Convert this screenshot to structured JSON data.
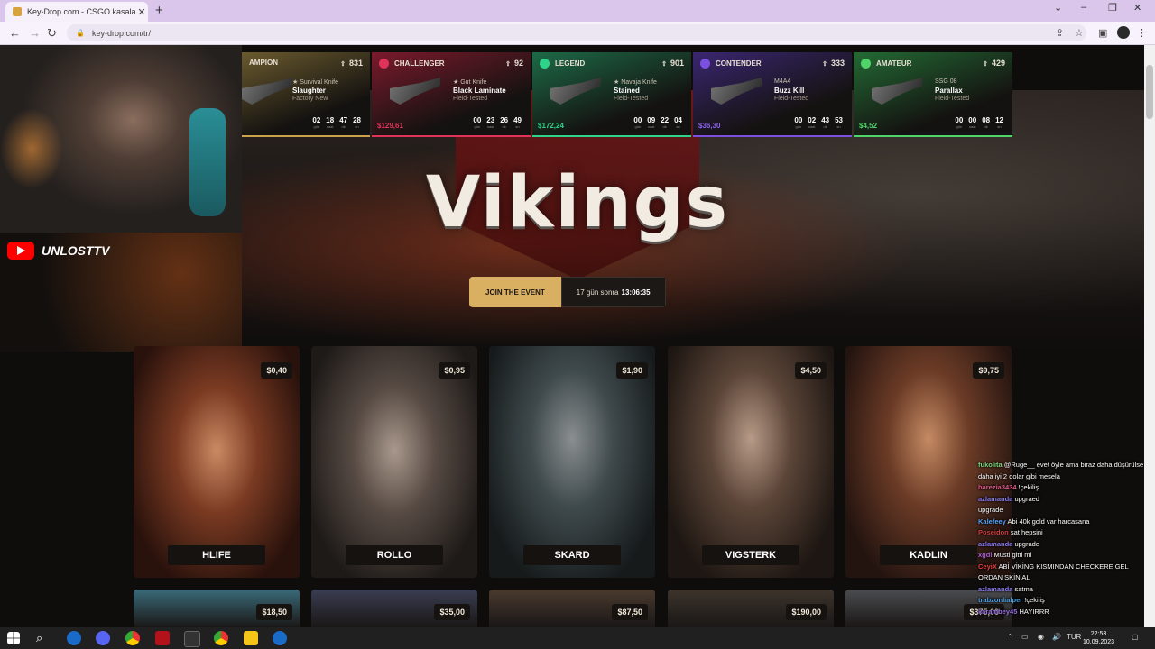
{
  "browser": {
    "tab_title": "Key-Drop.com - CSGO kasaların",
    "tab_close": "✕",
    "new_tab": "+",
    "url": "key-drop.com/tr/"
  },
  "stream": {
    "channel": "UNLOSTTV"
  },
  "ticker": [
    {
      "rank": "AMPION",
      "level": "831",
      "dot": "#c9a24a",
      "weapon": "★ Survival Knife",
      "skin": "Slaughter",
      "wear": "Factory New",
      "price": "",
      "price_color": "#e8c46a",
      "timer": [
        "02",
        "18",
        "47",
        "28"
      ],
      "accent": "#6a5a2e"
    },
    {
      "rank": "CHALLENGER",
      "level": "92",
      "dot": "#e0335a",
      "weapon": "★ Gut Knife",
      "skin": "Black Laminate",
      "wear": "Field-Tested",
      "price": "$129,61",
      "price_color": "#e0335a",
      "timer": [
        "00",
        "23",
        "26",
        "49"
      ],
      "accent": "#7a1a2c"
    },
    {
      "rank": "LEGEND",
      "level": "901",
      "dot": "#2fd48a",
      "weapon": "★ Navaja Knife",
      "skin": "Stained",
      "wear": "Field-Tested",
      "price": "$172,24",
      "price_color": "#2fd48a",
      "timer": [
        "00",
        "09",
        "22",
        "04"
      ],
      "accent": "#1d6a47"
    },
    {
      "rank": "CONTENDER",
      "level": "333",
      "dot": "#7b4fe0",
      "weapon": "M4A4",
      "skin": "Buzz Kill",
      "wear": "Field-Tested",
      "price": "$36,30",
      "price_color": "#8d63f0",
      "timer": [
        "00",
        "02",
        "43",
        "53"
      ],
      "accent": "#3a2670"
    },
    {
      "rank": "AMATEUR",
      "level": "429",
      "dot": "#4fd46a",
      "weapon": "SSG 08",
      "skin": "Parallax",
      "wear": "Field-Tested",
      "price": "$4,52",
      "price_color": "#4fd46a",
      "timer": [
        "00",
        "00",
        "08",
        "12"
      ],
      "accent": "#236a34"
    }
  ],
  "timer_units": [
    "gün",
    "saat",
    "dk",
    "sn"
  ],
  "event": {
    "title": "Vikings",
    "join_label": "JOIN THE EVENT",
    "countdown_prefix": "17 gün sonra",
    "countdown_time": "13:06:35"
  },
  "cases": [
    {
      "name": "HLIFE",
      "price": "$0,40"
    },
    {
      "name": "ROLLO",
      "price": "$0,95"
    },
    {
      "name": "SKARD",
      "price": "$1,90"
    },
    {
      "name": "VIGSTERK",
      "price": "$4,50"
    },
    {
      "name": "KADLIN",
      "price": "$9,75"
    }
  ],
  "cases_row2": [
    {
      "price": "$18,50"
    },
    {
      "price": "$35,00"
    },
    {
      "price": "$87,50"
    },
    {
      "price": "$190,00"
    },
    {
      "price": "$375,00"
    }
  ],
  "chat": [
    {
      "user": "fukolita",
      "user_color": "#7fd67f",
      "text": "@Ruge__ evet öyle ama biraz daha düşürülse daha iyi 2 dolar gibi mesela"
    },
    {
      "user": "barezia3434",
      "user_color": "#e05a8a",
      "text": "!çekiliş"
    },
    {
      "user": "azlamanda",
      "user_color": "#8a7bf0",
      "text": "upgraed"
    },
    {
      "user": "",
      "user_color": "#ffffff",
      "text": "upgrade"
    },
    {
      "user": "Kalefeey",
      "user_color": "#5aa0f0",
      "text": "Abi 40k gold var harcasana"
    },
    {
      "user": "Poseidon",
      "user_color": "#d04040",
      "text": "sat hepsini"
    },
    {
      "user": "azlamanda",
      "user_color": "#8a7bf0",
      "text": "upgrade"
    },
    {
      "user": "xgdi",
      "user_color": "#b060d0",
      "text": "Musti gitti mi"
    },
    {
      "user": "CeyiX",
      "user_color": "#e04040",
      "text": "ABİ VİKİNG KISMINDAN CHECKERE GEL ORDAN SKİN AL"
    },
    {
      "user": "azlamanda",
      "user_color": "#8a7bf0",
      "text": "satma"
    },
    {
      "user": "trabzonlialper",
      "user_color": "#4aa0e0",
      "text": "!çekiliş"
    },
    {
      "user": "karambey45",
      "user_color": "#9a70e0",
      "text": "HAYIRRR"
    }
  ],
  "taskbar": {
    "lang": "TUR",
    "time": "22:53",
    "date": "10.09.2023"
  }
}
